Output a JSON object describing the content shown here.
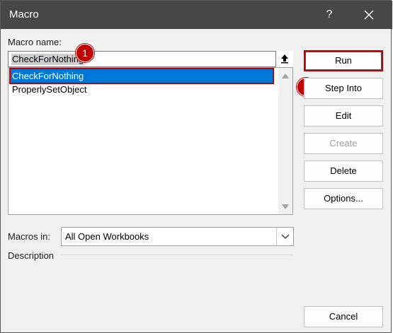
{
  "window": {
    "title": "Macro",
    "help_label": "?",
    "close_icon": "close-icon"
  },
  "macro_name": {
    "label": "Macro name:",
    "value": "CheckForNothing",
    "browse_icon": "upload-arrow-icon"
  },
  "macro_list": {
    "items": [
      "CheckForNothing",
      "ProperlySetObject"
    ],
    "selected_index": 0
  },
  "buttons": {
    "run": "Run",
    "step_into": "Step Into",
    "edit": "Edit",
    "create": "Create",
    "delete": "Delete",
    "options": "Options...",
    "cancel": "Cancel"
  },
  "macros_in": {
    "label": "Macros in:",
    "value": "All Open Workbooks"
  },
  "description": {
    "label": "Description"
  },
  "annotations": {
    "step1": "1",
    "step2": "2",
    "highlight_color": "#c00000"
  },
  "colors": {
    "titlebar": "#474747",
    "selection": "#0078d7",
    "dialog_bg": "#f0f0f0"
  }
}
